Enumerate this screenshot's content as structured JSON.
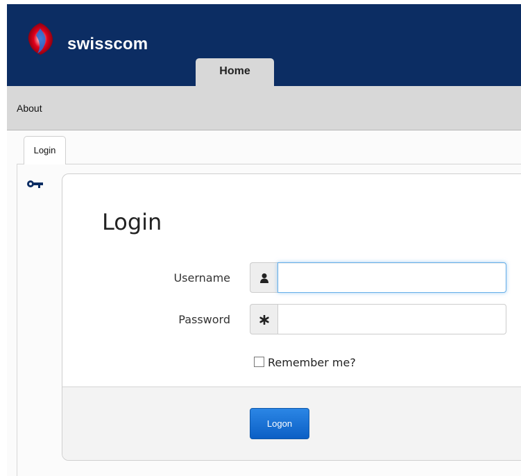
{
  "header": {
    "brand": "swisscom",
    "tabs": [
      {
        "label": "Home",
        "active": true
      }
    ]
  },
  "subnav": {
    "items": [
      {
        "label": "About"
      }
    ]
  },
  "page_tabs": [
    {
      "label": "Login",
      "active": true
    }
  ],
  "side_icon": "key-icon",
  "login_form": {
    "title": "Login",
    "username_label": "Username",
    "username_value": "",
    "username_icon": "user-icon",
    "password_label": "Password",
    "password_value": "",
    "password_icon": "asterisk-icon",
    "remember_label": "Remember me?",
    "remember_checked": false,
    "submit_label": "Logon"
  },
  "colors": {
    "header_bg": "#0c2d63",
    "nav_bg": "#d8d8d8",
    "button_blue": "#1a73d6",
    "focus_blue": "#66afe9"
  }
}
